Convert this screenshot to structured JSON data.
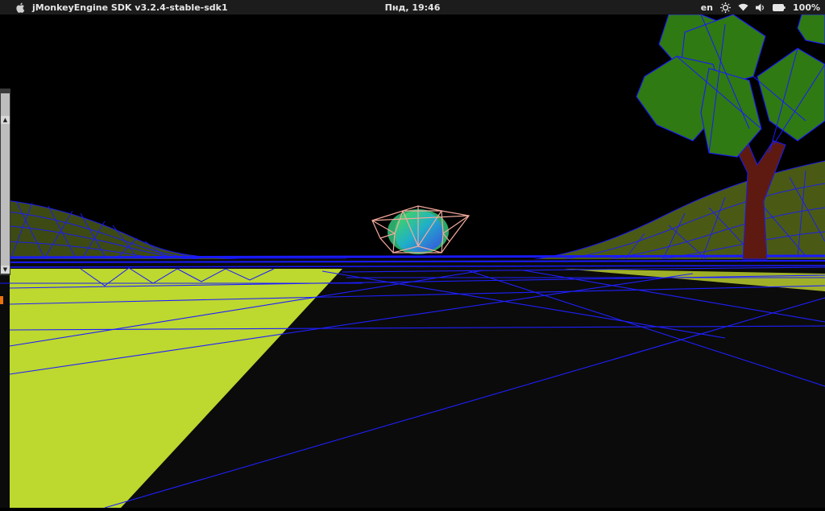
{
  "menubar": {
    "app_title": "jMonkeyEngine SDK v3.2.4-stable-sdk1",
    "clock": "Пнд, 19:46",
    "language": "en",
    "battery": "100%",
    "icons": [
      "apple-logo-icon",
      "brightness-icon",
      "wifi-icon",
      "volume-icon",
      "battery-icon"
    ]
  },
  "scene": {
    "colors": {
      "sky": "#000000",
      "ground": "#0a0a0a",
      "grass": "#bcd82e",
      "wireframe": "#1a1aff",
      "tree_leaves": "#2f7a12",
      "tree_trunk": "#5e1a10",
      "object_wire": "#f2a89a"
    }
  },
  "sidebar": {
    "scroll_up": "▲",
    "scroll_down": "▼"
  }
}
